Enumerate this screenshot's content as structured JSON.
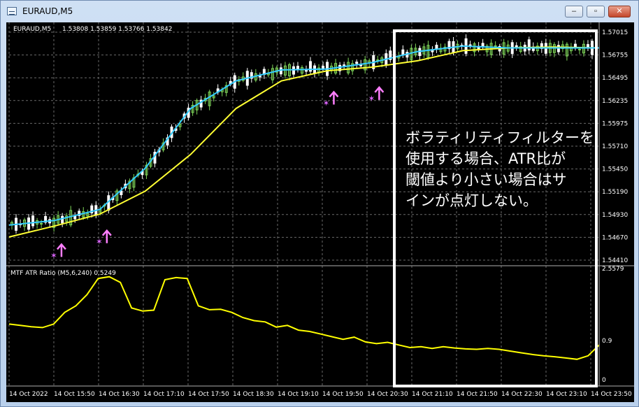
{
  "window": {
    "title": "EURAUD,M5"
  },
  "controls": {
    "minimize": "–",
    "maximize": "▫",
    "close": "✕"
  },
  "main_chart": {
    "header_symbol": "EURAUD,M5",
    "header_ohlc": "1.53808 1.53859 1.53766 1.53842",
    "price_ticks": [
      "1.57015",
      "1.56755",
      "1.56495",
      "1.56235",
      "1.55975",
      "1.55710",
      "1.55450",
      "1.55190",
      "1.54930",
      "1.54670",
      "1.54410"
    ]
  },
  "indicator": {
    "label": "MTF ATR Ratio  (M5,6,240) 0.5249",
    "ticks": [
      "2.5579",
      "0.9",
      "0"
    ]
  },
  "time_axis": [
    "14 Oct 2022",
    "14 Oct 15:50",
    "14 Oct 16:30",
    "14 Oct 17:10",
    "14 Oct 17:50",
    "14 Oct 18:30",
    "14 Oct 19:10",
    "14 Oct 19:50",
    "14 Oct 20:30",
    "14 Oct 21:10",
    "14 Oct 21:50",
    "14 Oct 22:30",
    "14 Oct 23:10",
    "14 Oct 23:50"
  ],
  "annotation": {
    "lines": [
      "ボラティリティフィルターを",
      "使用する場合、ATR比が",
      "閾値より小さい場合はサ",
      "インが点灯しない。"
    ]
  },
  "colors": {
    "bull": "#7fd65a",
    "bear": "#ffffff",
    "fast_ma": "#33ccff",
    "slow_ma": "#ffff33",
    "atr": "#ffff00",
    "signal_arrow": "#ff7fff",
    "signal_star": "#dd66ff",
    "highlight_box": "#ffffff"
  },
  "chart_data": {
    "type": "line",
    "title": "",
    "xlabel": "",
    "ylabel": "",
    "x": [
      "14 Oct 2022",
      "14 Oct 15:50",
      "14 Oct 16:30",
      "14 Oct 17:10",
      "14 Oct 17:50",
      "14 Oct 18:30",
      "14 Oct 19:10",
      "14 Oct 19:50",
      "14 Oct 20:30",
      "14 Oct 21:10",
      "14 Oct 21:50",
      "14 Oct 22:30",
      "14 Oct 23:10",
      "14 Oct 23:50"
    ],
    "ylim": [
      1.5441,
      1.57015
    ],
    "series": [
      {
        "name": "",
        "values": [
          1.547,
          1.5482,
          1.5495,
          1.552,
          1.556,
          1.561,
          1.564,
          1.5651,
          1.5655,
          1.5662,
          1.5673,
          1.5676,
          1.5677,
          1.5676
        ]
      },
      {
        "name": "",
        "values": [
          1.5483,
          1.5488,
          1.55,
          1.5545,
          1.561,
          1.564,
          1.5652,
          1.5653,
          1.566,
          1.5672,
          1.5678,
          1.5676,
          1.5676,
          1.5676
        ]
      }
    ],
    "price_range": [
      1.5441,
      1.57015
    ],
    "indicator_series": {
      "name": "MTF ATR Ratio",
      "ylim": [
        0,
        2.5579
      ],
      "threshold": 0.9,
      "values": [
        1.28,
        1.25,
        1.22,
        1.2,
        1.28,
        1.55,
        1.7,
        1.96,
        2.33,
        2.37,
        2.24,
        1.65,
        1.58,
        1.6,
        2.3,
        2.35,
        2.33,
        1.7,
        1.61,
        1.62,
        1.55,
        1.43,
        1.36,
        1.33,
        1.21,
        1.25,
        1.14,
        1.11,
        1.05,
        0.99,
        0.93,
        0.98,
        0.87,
        0.83,
        0.86,
        0.8,
        0.74,
        0.76,
        0.72,
        0.76,
        0.73,
        0.71,
        0.7,
        0.72,
        0.7,
        0.66,
        0.62,
        0.58,
        0.55,
        0.53,
        0.5,
        0.47,
        0.55,
        0.8
      ]
    },
    "signals": [
      {
        "x_index": 1,
        "price": 1.5462
      },
      {
        "x_index": 2,
        "price": 1.5477
      },
      {
        "x_index": 7,
        "price": 1.5628
      },
      {
        "x_index": 8,
        "price": 1.5633
      }
    ]
  }
}
